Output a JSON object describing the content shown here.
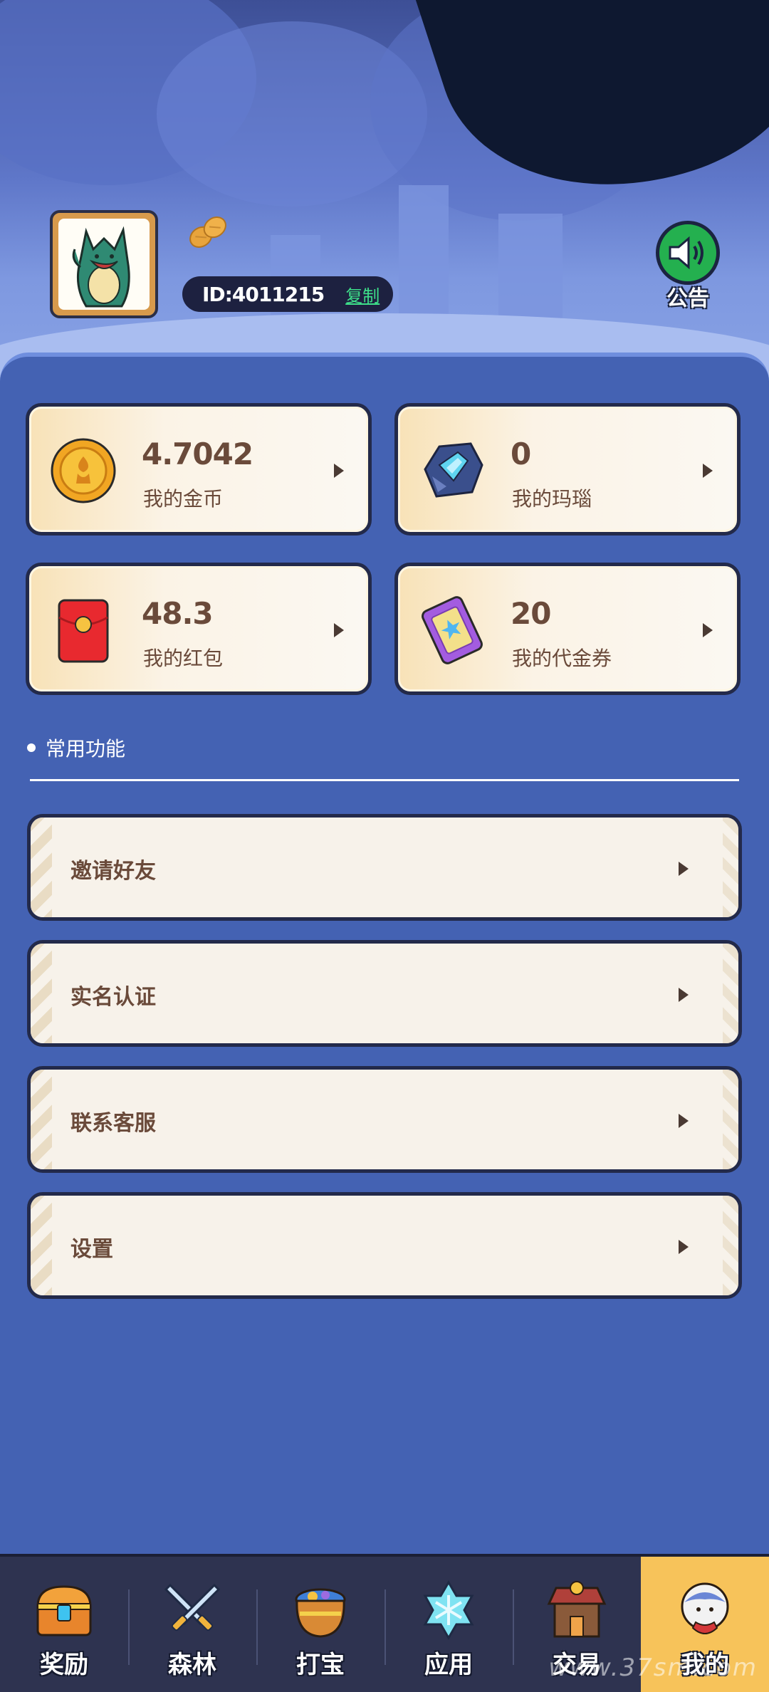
{
  "header": {
    "user_id": "ID:4011215",
    "copy_label": "复制",
    "notice_label": "公告"
  },
  "assets": [
    {
      "value": "4.7042",
      "name": "我的金币",
      "icon": "gold-coin-icon"
    },
    {
      "value": "0",
      "name": "我的玛瑙",
      "icon": "agate-gem-icon"
    },
    {
      "value": "48.3",
      "name": "我的红包",
      "icon": "red-envelope-icon"
    },
    {
      "value": "20",
      "name": "我的代金券",
      "icon": "voucher-ticket-icon"
    }
  ],
  "section": {
    "title": "常用功能"
  },
  "menu": [
    {
      "label": "邀请好友"
    },
    {
      "label": "实名认证"
    },
    {
      "label": "联系客服"
    },
    {
      "label": "设置"
    }
  ],
  "tabs": [
    {
      "label": "奖励",
      "icon": "treasure-chest-icon"
    },
    {
      "label": "森林",
      "icon": "crossed-swords-icon"
    },
    {
      "label": "打宝",
      "icon": "treasure-pot-icon"
    },
    {
      "label": "应用",
      "icon": "snowflake-icon"
    },
    {
      "label": "交易",
      "icon": "shop-icon"
    },
    {
      "label": "我的",
      "icon": "profile-character-icon",
      "active": true
    }
  ],
  "watermark": "www.37sm.com",
  "colors": {
    "background": "#4462b3",
    "card_border": "#232a4a",
    "text_brown": "#6a4a3a",
    "active_tab": "#f7c35a",
    "notice_green": "#24b04f"
  }
}
